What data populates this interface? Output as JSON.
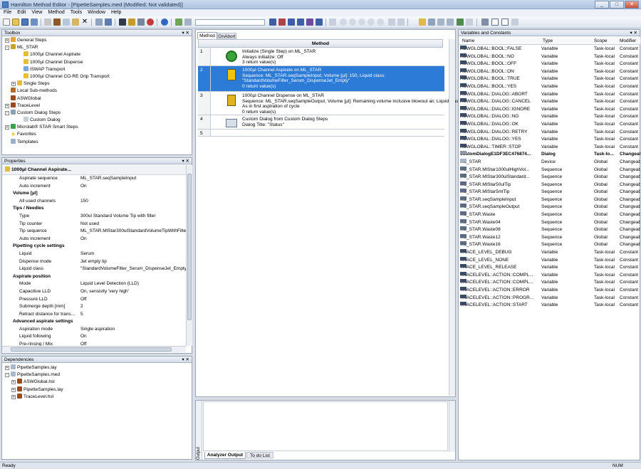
{
  "window": {
    "title": "Hamilton Method Editor - [PipetteSamples.med (Modified; Not validated)]",
    "min": "_",
    "max": "□",
    "close": "✕"
  },
  "menu": [
    "File",
    "Edit",
    "View",
    "Method",
    "Tools",
    "Window",
    "Help"
  ],
  "toolbox": {
    "title": "Toolbox",
    "items": [
      {
        "label": "General Steps",
        "indent": 0,
        "exp": "+",
        "icon": "#e6a23c",
        "kind": "folder"
      },
      {
        "label": "ML_STAR",
        "indent": 0,
        "exp": "-",
        "icon": "#c9a227",
        "kind": "device"
      },
      {
        "label": "1000µl Channel Aspirate",
        "indent": 2,
        "exp": "",
        "icon": "#e1c033",
        "kind": "step"
      },
      {
        "label": "1000µl Channel Dispense",
        "indent": 2,
        "exp": "",
        "icon": "#e1c033",
        "kind": "step"
      },
      {
        "label": "iSWAP Transport",
        "indent": 2,
        "exp": "",
        "icon": "#7aa6d8",
        "kind": "step"
      },
      {
        "label": "1000µl Channel CO-RE Grip Transport",
        "indent": 2,
        "exp": "",
        "icon": "#e1c033",
        "kind": "step"
      },
      {
        "label": "Single Steps",
        "indent": 1,
        "exp": "+",
        "icon": "#e1c033",
        "kind": "folder"
      },
      {
        "label": "Local Sub-methods",
        "indent": 0,
        "exp": "",
        "icon": "#b56a2b",
        "kind": "folder"
      },
      {
        "label": "ASWGlobal",
        "indent": 0,
        "exp": "",
        "icon": "#9a4a1c",
        "kind": "lib"
      },
      {
        "label": "TraceLevel",
        "indent": 0,
        "exp": "+",
        "icon": "#9a4a1c",
        "kind": "lib"
      },
      {
        "label": "Custom Dialog Steps",
        "indent": 0,
        "exp": "-",
        "icon": "#8fa0b5",
        "kind": "folder"
      },
      {
        "label": "Custom Dialog",
        "indent": 2,
        "exp": "",
        "icon": "#c4cfdc",
        "kind": "step"
      },
      {
        "label": "Microlab® STAR Smart Steps",
        "indent": 0,
        "exp": "+",
        "icon": "#3aa04a",
        "kind": "folder"
      },
      {
        "label": "Favorites",
        "indent": 0,
        "exp": "",
        "icon": "#f0c419",
        "kind": "star"
      },
      {
        "label": "Templates",
        "indent": 0,
        "exp": "",
        "icon": "#9ab0c8",
        "kind": "folder"
      }
    ]
  },
  "properties": {
    "title": "Properties",
    "header": "1000µl Channel Aspirate...",
    "rows": [
      {
        "k": "Aspirate sequence",
        "v": "ML_STAR.seqSampleInput",
        "g": false
      },
      {
        "k": "Auto increment",
        "v": "On",
        "g": false
      },
      {
        "k": "Volume [µl]",
        "v": "",
        "g": true
      },
      {
        "k": "All used channels",
        "v": "150",
        "g": false
      },
      {
        "k": "Tips / Needles",
        "v": "",
        "g": true
      },
      {
        "k": "Type",
        "v": "300ul Standard Volume Tip with filter",
        "g": false
      },
      {
        "k": "Tip counter",
        "v": "Not used",
        "g": false
      },
      {
        "k": "Tip sequence",
        "v": "ML_STAR.MlStar300ulStandardVolumeTipWithFilter",
        "g": false
      },
      {
        "k": "Auto increment",
        "v": "On",
        "g": false
      },
      {
        "k": "Pipetting cycle settings",
        "v": "",
        "g": true
      },
      {
        "k": "Liquid",
        "v": "Serum",
        "g": false
      },
      {
        "k": "Dispense mode",
        "v": "Jet empty tip",
        "g": false
      },
      {
        "k": "Liquid class",
        "v": "\"StandardVolumeFilter_Serum_DispenseJet_Empty\"",
        "g": false
      },
      {
        "k": "Aspirate position",
        "v": "",
        "g": true
      },
      {
        "k": "Mode",
        "v": "Liquid Level Detection (LLD)",
        "g": false
      },
      {
        "k": "Capacitive LLD",
        "v": "On, sensivity 'very high'",
        "g": false
      },
      {
        "k": "Pressure LLD",
        "v": "Off",
        "g": false
      },
      {
        "k": "Submerge depth [mm]",
        "v": "2",
        "g": false
      },
      {
        "k": "Retract distance for trans...",
        "v": "5",
        "g": false
      },
      {
        "k": "Advanced aspirate settings",
        "v": "",
        "g": true
      },
      {
        "k": "Aspiration mode",
        "v": "Single aspiration",
        "g": false
      },
      {
        "k": "Liquid following",
        "v": "On",
        "g": false
      },
      {
        "k": "Pre-rinsing / Mix",
        "v": "Off",
        "g": false
      }
    ]
  },
  "dependencies": {
    "title": "Dependencies",
    "items": [
      {
        "label": "PipetteSamples.lay",
        "indent": 0,
        "exp": "+"
      },
      {
        "label": "PipetteSamples.med",
        "indent": 0,
        "exp": "-"
      },
      {
        "label": "ASWGlobal.hsl",
        "indent": 1,
        "exp": "+"
      },
      {
        "label": "PipetteSamples.lay",
        "indent": 1,
        "exp": "+"
      },
      {
        "label": "TraceLevel.hsl",
        "indent": 1,
        "exp": "+"
      }
    ]
  },
  "method": {
    "tabs": [
      "Method",
      "OnAbort"
    ],
    "header": "Method",
    "steps": [
      {
        "num": "1",
        "lines": [
          "Initialize (Single Step) on ML_STAR",
          "Always initialize: Off",
          "3 return value(s)"
        ],
        "icon": "init",
        "sel": false
      },
      {
        "num": "2",
        "lines": [
          "1000µl Channel Aspirate on ML_STAR",
          "Sequence: ML_STAR.seqSampleInput, Volume [µl]: 150, Liquid class:",
          "\"StandardVolumeFilter_Serum_DispenseJet_Empty\"",
          "0 return value(s)"
        ],
        "icon": "asp",
        "sel": true
      },
      {
        "num": "3",
        "lines": [
          "1000µl Channel Dispense on ML_STAR",
          "Sequence: ML_STAR.seqSampleOutput, Volume [µl]: Remaining volume inclusive blowout air, Liquid class:",
          "As in first aspiration of cycle",
          "0 return value(s)"
        ],
        "icon": "disp",
        "sel": false
      },
      {
        "num": "4",
        "lines": [
          "Custom Dialog from Custom Dialog Steps",
          "Dialog Title: \"Status\""
        ],
        "icon": "dlg",
        "sel": false
      },
      {
        "num": "5",
        "lines": [],
        "icon": "",
        "sel": false
      }
    ]
  },
  "output": {
    "tabs": [
      "Analyzer Output",
      "To do List"
    ],
    "side_label": "Output"
  },
  "variables": {
    "title": "Variables and Constants",
    "cols": [
      "Name",
      "Type",
      "Scope",
      "Modifier"
    ],
    "rows": [
      {
        "n": "ASWGLOBAL::BOOL::FALSE",
        "t": "Variable",
        "s": "Task-local",
        "m": "Constant",
        "ic": "v",
        "b": false
      },
      {
        "n": "ASWGLOBAL::BOOL::NO",
        "t": "Variable",
        "s": "Task-local",
        "m": "Constant",
        "ic": "v",
        "b": false
      },
      {
        "n": "ASWGLOBAL::BOOL::OFF",
        "t": "Variable",
        "s": "Task-local",
        "m": "Constant",
        "ic": "v",
        "b": false
      },
      {
        "n": "ASWGLOBAL::BOOL::ON",
        "t": "Variable",
        "s": "Task-local",
        "m": "Constant",
        "ic": "v",
        "b": false
      },
      {
        "n": "ASWGLOBAL::BOOL::TRUE",
        "t": "Variable",
        "s": "Task-local",
        "m": "Constant",
        "ic": "v",
        "b": false
      },
      {
        "n": "ASWGLOBAL::BOOL::YES",
        "t": "Variable",
        "s": "Task-local",
        "m": "Constant",
        "ic": "v",
        "b": false
      },
      {
        "n": "ASWGLOBAL::DIALOG::ABORT",
        "t": "Variable",
        "s": "Task-local",
        "m": "Constant",
        "ic": "v",
        "b": false
      },
      {
        "n": "ASWGLOBAL::DIALOG::CANCEL",
        "t": "Variable",
        "s": "Task-local",
        "m": "Constant",
        "ic": "v",
        "b": false
      },
      {
        "n": "ASWGLOBAL::DIALOG::IGNORE",
        "t": "Variable",
        "s": "Task-local",
        "m": "Constant",
        "ic": "v",
        "b": false
      },
      {
        "n": "ASWGLOBAL::DIALOG::NO",
        "t": "Variable",
        "s": "Task-local",
        "m": "Constant",
        "ic": "v",
        "b": false
      },
      {
        "n": "ASWGLOBAL::DIALOG::OK",
        "t": "Variable",
        "s": "Task-local",
        "m": "Constant",
        "ic": "v",
        "b": false
      },
      {
        "n": "ASWGLOBAL::DIALOG::RETRY",
        "t": "Variable",
        "s": "Task-local",
        "m": "Constant",
        "ic": "v",
        "b": false
      },
      {
        "n": "ASWGLOBAL::DIALOG::YES",
        "t": "Variable",
        "s": "Task-local",
        "m": "Constant",
        "ic": "v",
        "b": false
      },
      {
        "n": "ASWGLOBAL::TIMER::STOP",
        "t": "Variable",
        "s": "Task-local",
        "m": "Constant",
        "ic": "v",
        "b": false
      },
      {
        "n": "customDialogE1DF3EC476874...",
        "t": "Dialog",
        "s": "Task-lo...",
        "m": "Changeable",
        "ic": "d",
        "b": true
      },
      {
        "n": "ML_STAR",
        "t": "Device",
        "s": "Global",
        "m": "Changeable",
        "ic": "dev",
        "b": false
      },
      {
        "n": "ML_STAR.MlStar1000ulHighVol...",
        "t": "Sequence",
        "s": "Global",
        "m": "Changeable",
        "ic": "s",
        "b": false
      },
      {
        "n": "ML_STAR.MlStar300ulStandard...",
        "t": "Sequence",
        "s": "Global",
        "m": "Changeable",
        "ic": "s",
        "b": false
      },
      {
        "n": "ML_STAR.MlStar50ulTip",
        "t": "Sequence",
        "s": "Global",
        "m": "Changeable",
        "ic": "s",
        "b": false
      },
      {
        "n": "ML_STAR.MlStar5mlTip",
        "t": "Sequence",
        "s": "Global",
        "m": "Changeable",
        "ic": "s",
        "b": false
      },
      {
        "n": "ML_STAR.seqSampleInput",
        "t": "Sequence",
        "s": "Global",
        "m": "Changeable",
        "ic": "s",
        "b": false
      },
      {
        "n": "ML_STAR.seqSampleOutput",
        "t": "Sequence",
        "s": "Global",
        "m": "Changeable",
        "ic": "s",
        "b": false
      },
      {
        "n": "ML_STAR.Waste",
        "t": "Sequence",
        "s": "Global",
        "m": "Changeable",
        "ic": "s",
        "b": false
      },
      {
        "n": "ML_STAR.Waste04",
        "t": "Sequence",
        "s": "Global",
        "m": "Changeable",
        "ic": "s",
        "b": false
      },
      {
        "n": "ML_STAR.Waste08",
        "t": "Sequence",
        "s": "Global",
        "m": "Changeable",
        "ic": "s",
        "b": false
      },
      {
        "n": "ML_STAR.Waste12",
        "t": "Sequence",
        "s": "Global",
        "m": "Changeable",
        "ic": "s",
        "b": false
      },
      {
        "n": "ML_STAR.Waste16",
        "t": "Sequence",
        "s": "Global",
        "m": "Changeable",
        "ic": "s",
        "b": false
      },
      {
        "n": "TRACE_LEVEL_DEBUG",
        "t": "Variable",
        "s": "Task-local",
        "m": "Constant",
        "ic": "v",
        "b": false
      },
      {
        "n": "TRACE_LEVEL_NONE",
        "t": "Variable",
        "s": "Task-local",
        "m": "Constant",
        "ic": "v",
        "b": false
      },
      {
        "n": "TRACE_LEVEL_RELEASE",
        "t": "Variable",
        "s": "Task-local",
        "m": "Constant",
        "ic": "v",
        "b": false
      },
      {
        "n": "TRACELEVEL::ACTION::COMPL...",
        "t": "Variable",
        "s": "Task-local",
        "m": "Constant",
        "ic": "v",
        "b": false
      },
      {
        "n": "TRACELEVEL::ACTION::COMPL...",
        "t": "Variable",
        "s": "Task-local",
        "m": "Constant",
        "ic": "v",
        "b": false
      },
      {
        "n": "TRACELEVEL::ACTION::ERROR",
        "t": "Variable",
        "s": "Task-local",
        "m": "Constant",
        "ic": "v",
        "b": false
      },
      {
        "n": "TRACELEVEL::ACTION::PROGR...",
        "t": "Variable",
        "s": "Task-local",
        "m": "Constant",
        "ic": "v",
        "b": false
      },
      {
        "n": "TRACELEVEL::ACTION::START",
        "t": "Variable",
        "s": "Task-local",
        "m": "Constant",
        "ic": "v",
        "b": false
      }
    ]
  },
  "status": {
    "left": "Ready",
    "right": "NUM"
  },
  "colors": {
    "selection": "#2c7bd6",
    "panel_border": "#9aa7b8"
  }
}
